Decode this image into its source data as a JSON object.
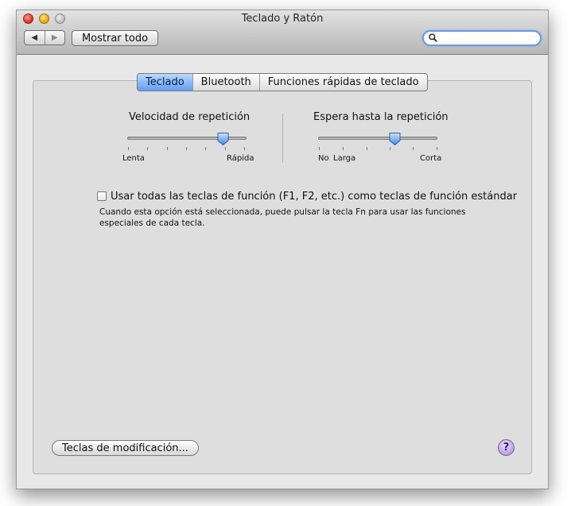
{
  "window": {
    "title": "Teclado y Ratón",
    "nav_back": "◀",
    "nav_forward": "▶",
    "show_all_label": "Mostrar todo",
    "search_placeholder": ""
  },
  "tabs": [
    {
      "label": "Teclado",
      "active": true
    },
    {
      "label": "Bluetooth",
      "active": false
    },
    {
      "label": "Funciones rápidas de teclado",
      "active": false
    }
  ],
  "key_repeat": {
    "label": "Velocidad de repetición",
    "min_label": "Lenta",
    "max_label": "Rápida",
    "value": 0.8
  },
  "delay_until_repeat": {
    "label": "Espera hasta la repetición",
    "left_label_1": "No",
    "left_label_2": "Larga",
    "right_label": "Corta",
    "value": 0.64
  },
  "function_keys": {
    "checked": false,
    "label": "Usar todas las teclas de función (F1, F2, etc.) como teclas de función estándar",
    "description_line1": "Cuando esta opción está seleccionada, puede pulsar la tecla Fn para usar las funciones",
    "description_line2": "especiales de cada tecla."
  },
  "footer": {
    "modifier_keys_label": "Teclas de modificación...",
    "help_label": "?"
  },
  "colors": {
    "accent": "#5e9ef5",
    "help_button": "#b796ee"
  }
}
